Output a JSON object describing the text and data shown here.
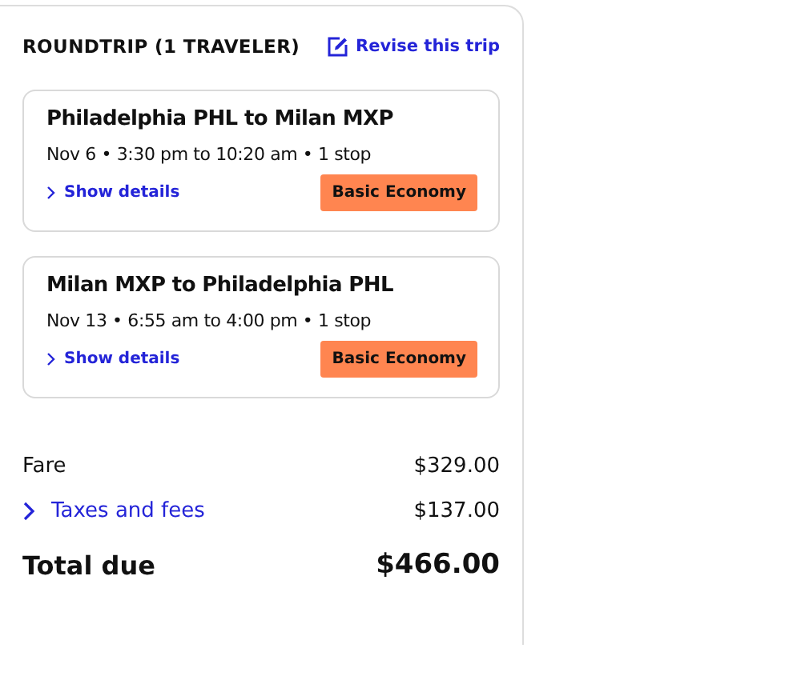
{
  "summary": {
    "title": "ROUNDTRIP (1 TRAVELER)",
    "revise_link": "Revise this trip"
  },
  "flights": [
    {
      "route": "Philadelphia PHL to Milan MXP",
      "details": "Nov 6 • 3:30 pm to 10:20 am • 1 stop",
      "show_details": "Show details",
      "fare_class": "Basic Economy"
    },
    {
      "route": "Milan MXP to Philadelphia PHL",
      "details": "Nov 13 • 6:55 am to 4:00 pm • 1 stop",
      "show_details": "Show details",
      "fare_class": "Basic Economy"
    }
  ],
  "price_lines": [
    {
      "kind": "plain",
      "label": "Fare",
      "amount": "$329.00"
    },
    {
      "kind": "expandable",
      "label": "Taxes and fees",
      "amount": "$137.00"
    },
    {
      "kind": "total",
      "label": "Total due",
      "amount": "$466.00"
    }
  ]
}
